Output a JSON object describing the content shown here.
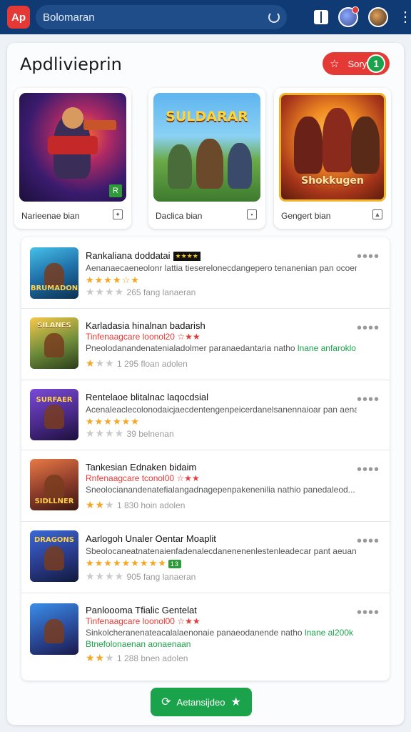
{
  "topbar": {
    "logo_text": "Ap",
    "search_text": "Bolomaran",
    "notification_count": "2"
  },
  "page": {
    "title": "Apdlivieprin",
    "story_button": {
      "label": "Sory",
      "count": "1"
    }
  },
  "featured": [
    {
      "art_title": "",
      "label": "Narieenae bian",
      "icon": "star-tool-icon"
    },
    {
      "art_title": "SULDARAR",
      "label": "Daclica bian",
      "icon": "save-icon"
    },
    {
      "art_title": "Shokkugen",
      "label": "Gengert bian",
      "icon": "image-icon"
    }
  ],
  "list": [
    {
      "thumb_text": "BRUMADON",
      "title": "Rankaliana doddatai",
      "tag": "★★★★",
      "subtitle": "",
      "desc": "Aenanaecaeneolonr lattia tieserelonecdangepero tenanenian pan ocoemed...",
      "desc_highlight": "",
      "stars": "★★★★☆★",
      "meta_stars": [
        0,
        0,
        0,
        0
      ],
      "meta_text": "265 fang lanaeran"
    },
    {
      "thumb_text": "SILANES",
      "title": "Karladasia hinalnan badarish",
      "tag": "",
      "subtitle": "Tinfenaagcare loonol20 ☆★★",
      "desc": "Pneolodanandenatenialadolmer paranaedantaria natho ",
      "desc_highlight": "lnane anfaroklo",
      "stars": "",
      "meta_stars": [
        1,
        0,
        0,
        0
      ],
      "meta_text": "1 295 floan adolen"
    },
    {
      "thumb_text": "SURFAER",
      "title": "Rentelaoe blitalnac laqocdsial",
      "tag": "",
      "subtitle": "",
      "desc": "Acenaleaclecolonodaicjaecdentengenpeicerdanelsanennaioar pan aenaed...",
      "desc_highlight": "",
      "stars": "★★★★★★",
      "meta_stars": [
        0,
        0,
        0,
        0
      ],
      "meta_text": "39 belnenan"
    },
    {
      "thumb_text": "SIDLLNER",
      "title": "Tankesian Ednaken bidaim",
      "tag": "",
      "subtitle": "Rnfenaagcare tconol00 ☆★★",
      "desc": "Sneolocianandenatefialangadnagepenpakenenilia nathio panedaleod...",
      "desc_highlight": "",
      "stars": "",
      "meta_stars": [
        1,
        1,
        0,
        0
      ],
      "meta_text": "1 830 hoin adolen"
    },
    {
      "thumb_text": "DRAGONS",
      "title": "Aarlogoh Unaler Oentar Moaplit",
      "tag": "",
      "subtitle": "",
      "desc": "Sbeolocaneatnatenaienfadenalecdanenenenlestenleadecar pant aeuaned...",
      "desc_highlight": "",
      "stars": "★★★★★★★★★",
      "stars_tag": "13",
      "meta_stars": [
        0,
        0,
        0,
        0
      ],
      "meta_text": "905 fang lanaeran"
    },
    {
      "thumb_text": "",
      "title": "Panloooma Tfialic Gentelat",
      "tag": "",
      "subtitle": "Tinfenaagcare loonol00 ☆★★",
      "desc": "Sinkolcheranenateacalalaenonaie panaeodanende natho ",
      "desc_highlight": "lnane al200k",
      "desc2": "Btnefolonaenan aonaenaan",
      "stars": "",
      "meta_stars": [
        1,
        1,
        0,
        0
      ],
      "meta_text": "1 288 bnen adolen"
    }
  ],
  "cta": {
    "label": "Aetansijdeo"
  },
  "colors": {
    "topbar": "#0f3a73",
    "accent_red": "#e53935",
    "accent_green": "#1aa34a",
    "star": "#f5a623"
  }
}
